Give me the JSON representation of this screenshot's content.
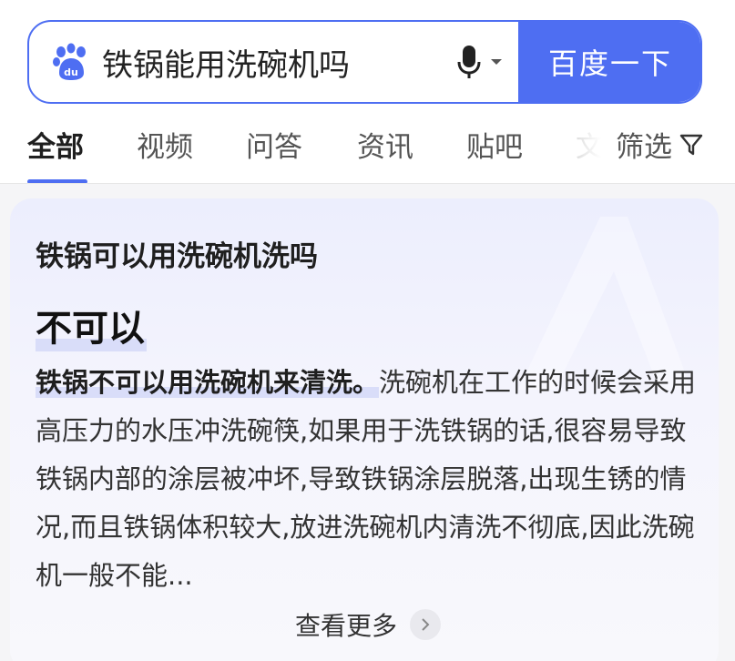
{
  "search": {
    "query": "铁锅能用洗碗机吗",
    "submit_label": "百度一下"
  },
  "tabs": [
    {
      "label": "全部",
      "active": true
    },
    {
      "label": "视频"
    },
    {
      "label": "问答"
    },
    {
      "label": "资讯"
    },
    {
      "label": "贴吧"
    },
    {
      "label": "文"
    }
  ],
  "filter_label": "筛选",
  "answer_card": {
    "question": "铁锅可以用洗碗机洗吗",
    "answer": "不可以",
    "body_highlight": "铁锅不可以用洗碗机来清洗。",
    "body_text": "洗碗机在工作的时候会采用高压力的水压冲洗碗筷,如果用于洗铁锅的话,很容易导致铁锅内部的涂层被冲坏,导致铁锅涂层脱落,出现生锈的情况,而且铁锅体积较大,放进洗碗机内清洗不彻底,因此洗碗机一般不能...",
    "see_more_label": "查看更多"
  },
  "colors": {
    "brand_blue": "#4e6ef2",
    "highlight": "#d9ddf9"
  },
  "icons": {
    "logo": "baidu-paw-logo",
    "voice": "microphone-icon",
    "dropdown": "caret-down-icon",
    "filter": "funnel-icon",
    "see_more": "chevron-right-icon"
  }
}
